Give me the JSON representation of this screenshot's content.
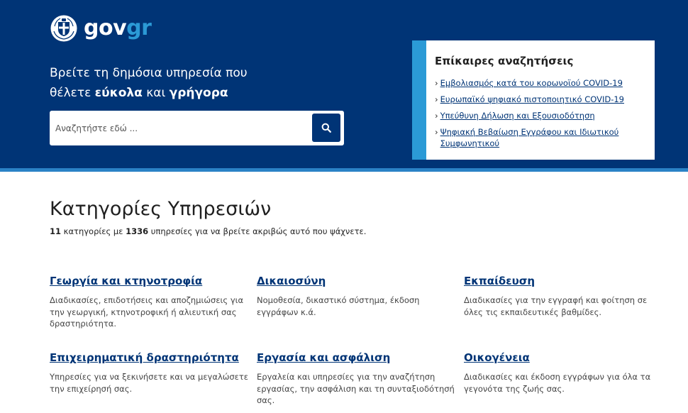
{
  "brand": {
    "word_gov": "gov",
    "word_gr": "gr",
    "emblem_icon": "greek-coat-of-arms-icon"
  },
  "hero": {
    "tagline_line1": "Βρείτε τη δημόσια υπηρεσία που",
    "tagline_line2_pre": "θέλετε ",
    "tagline_bold1": "εύκολα",
    "tagline_mid": " και ",
    "tagline_bold2": "γρήγορα"
  },
  "search": {
    "placeholder": "Αναζητήστε εδώ ...",
    "button_icon": "search-icon"
  },
  "trending": {
    "title": "Επίκαιρες αναζητήσεις",
    "arrow": "›",
    "items": [
      {
        "label": "Εμβολιασμός κατά του κορωνοϊού COVID-19"
      },
      {
        "label": "Ευρωπαϊκό ψηφιακό πιστοποιητικό COVID-19"
      },
      {
        "label": "Υπεύθυνη Δήλωση και Εξουσιοδότηση"
      },
      {
        "label": "Ψηφιακή Βεβαίωση Εγγράφου και Ιδιωτικού Συμφωνητικού"
      }
    ]
  },
  "categories_section": {
    "title": "Κατηγορίες Υπηρεσιών",
    "count_categories": "11",
    "text1": " κατηγορίες με ",
    "count_services": "1336",
    "text2": " υπηρεσίες για να βρείτε ακριβώς αυτό που ψάχνετε."
  },
  "categories": [
    {
      "title": "Γεωργία και κτηνοτροφία",
      "desc": "Διαδικασίες, επιδοτήσεις και αποζημιώσεις για την γεωργική, κτηνοτροφική ή αλιευτική σας δραστηριότητα."
    },
    {
      "title": "Δικαιοσύνη",
      "desc": "Νομοθεσία, δικαστικό σύστημα, έκδοση εγγράφων κ.ά."
    },
    {
      "title": "Εκπαίδευση",
      "desc": "Διαδικασίες για την εγγραφή και φοίτηση σε όλες τις εκπαιδευτικές βαθμίδες."
    },
    {
      "title": "Επιχειρηματική δραστηριότητα",
      "desc": "Υπηρεσίες για να ξεκινήσετε και να μεγαλώσετε την επιχείρησή σας."
    },
    {
      "title": "Εργασία και ασφάλιση",
      "desc": "Εργαλεία και υπηρεσίες για την αναζήτηση εργασίας, την ασφάλιση και τη συνταξιοδότησή σας."
    },
    {
      "title": "Οικογένεια",
      "desc": "Διαδικασίες και έκδοση εγγράφων για όλα τα γεγονότα της ζωής σας."
    }
  ],
  "colors": {
    "hero_bg": "#003476",
    "accent": "#2b9ad6",
    "link": "#003476"
  }
}
